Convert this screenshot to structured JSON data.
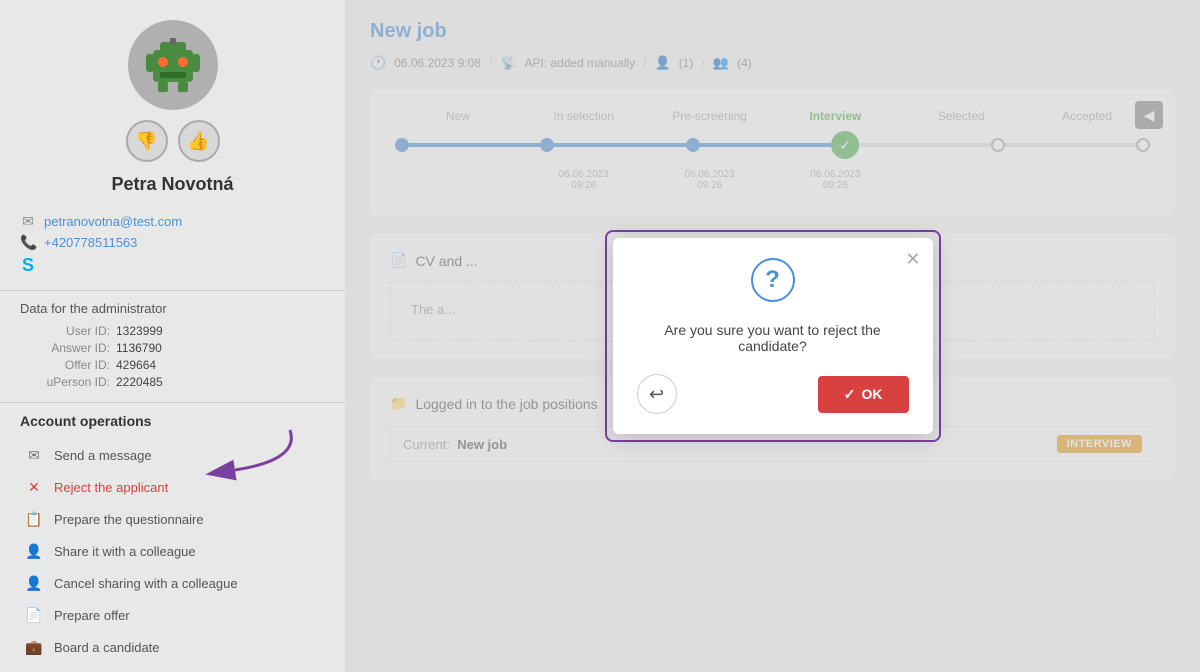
{
  "sidebar": {
    "candidate": {
      "name": "Petra Novotná",
      "email": "petranovotna@test.com",
      "phone": "+420778511563",
      "thumb_down_label": "👎",
      "thumb_up_label": "👍"
    },
    "admin_data": {
      "heading": "Data for the administrator",
      "user_id_label": "User ID:",
      "user_id_value": "1323999",
      "answer_id_label": "Answer ID:",
      "answer_id_value": "1136790",
      "offer_id_label": "Offer ID:",
      "offer_id_value": "429664",
      "uperson_id_label": "uPerson ID:",
      "uperson_id_value": "2220485"
    },
    "account_ops": {
      "heading": "Account operations",
      "items": [
        {
          "id": "send-message",
          "label": "Send a message",
          "icon": "✉"
        },
        {
          "id": "reject-applicant",
          "label": "Reject the applicant",
          "icon": "✕",
          "class": "reject"
        },
        {
          "id": "prepare-questionnaire",
          "label": "Prepare the questionnaire",
          "icon": "📋"
        },
        {
          "id": "share-colleague",
          "label": "Share it with a colleague",
          "icon": "👤"
        },
        {
          "id": "cancel-sharing",
          "label": "Cancel sharing with a colleague",
          "icon": "👤"
        },
        {
          "id": "prepare-offer",
          "label": "Prepare offer",
          "icon": "📄"
        },
        {
          "id": "board-candidate",
          "label": "Board a candidate",
          "icon": "💼"
        }
      ]
    }
  },
  "main": {
    "job_title": "New job",
    "meta": {
      "date": "06.06.2023 9:08",
      "source": "API: added manually",
      "count1": "(1)",
      "count2": "(4)"
    },
    "stages": [
      {
        "label": "New",
        "filled": true,
        "timestamp": "",
        "has_time": false
      },
      {
        "label": "In selection",
        "filled": true,
        "timestamp": "06.06.2023\n09:26",
        "has_time": true
      },
      {
        "label": "Pre-screening",
        "filled": true,
        "timestamp": "06.06.2023\n09:26",
        "has_time": true
      },
      {
        "label": "Interview",
        "filled": true,
        "active": true,
        "timestamp": "06.06.2023\n09:26",
        "has_time": true
      },
      {
        "label": "Selected",
        "filled": false,
        "timestamp": "",
        "has_time": false
      },
      {
        "label": "Accepted",
        "filled": false,
        "timestamp": "",
        "has_time": false
      }
    ],
    "cv_panel": {
      "title": "CV and ...",
      "content": "The a..."
    },
    "logged": {
      "title": "Logged in to the job positions",
      "current_label": "Current:",
      "current_job": "New job",
      "badge": "INTERVIEW"
    }
  },
  "modal": {
    "question_icon": "?",
    "message": "Are you sure you want to reject the candidate?",
    "close_icon": "✕",
    "back_icon": "↩",
    "ok_label": "OK",
    "ok_check": "✓"
  }
}
